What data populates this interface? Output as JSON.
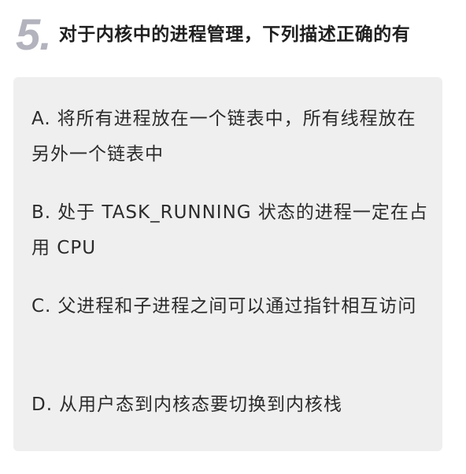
{
  "question": {
    "number": "5.",
    "text": "对于内核中的进程管理，下列描述正确的有"
  },
  "options": [
    {
      "letter": "A.",
      "text": "将所有进程放在一个链表中，所有线程放在另外一个链表中"
    },
    {
      "letter": "B.",
      "text": "处于 TASK_RUNNING 状态的进程一定在占用 CPU"
    },
    {
      "letter": "C.",
      "text": "父进程和子进程之间可以通过指针相互访问"
    },
    {
      "letter": "D.",
      "text": "从用户态到内核态要切换到内核栈"
    }
  ]
}
